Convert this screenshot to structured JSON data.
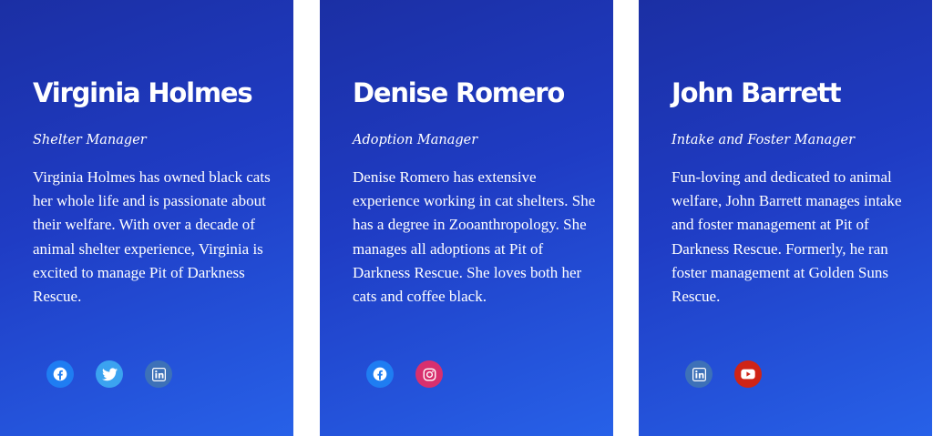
{
  "colors": {
    "card_gradient_start": "#1b2fa4",
    "card_gradient_end": "#2761e8",
    "text": "#ffffff",
    "facebook": "#1f7df2",
    "twitter": "#3ba3f0",
    "linkedin": "#3d71b8",
    "instagram": "#d8306e",
    "youtube": "#cf2416"
  },
  "team": [
    {
      "name": "Virginia Holmes",
      "role": "Shelter Manager",
      "bio": "Virginia Holmes has owned black cats her whole life and is passionate about their welfare. With over a decade of animal shelter experience, Virginia is excited to manage Pit of Darkness Rescue.",
      "socials": [
        "facebook-icon",
        "twitter-icon",
        "linkedin-icon"
      ]
    },
    {
      "name": "Denise Romero",
      "role": "Adoption Manager",
      "bio": "Denise Romero has extensive experience working in cat shelters. She has a degree in Zooanthropology. She manages all adoptions at Pit of Darkness Rescue. She loves both her cats and coffee black.",
      "socials": [
        "facebook-icon",
        "instagram-icon"
      ]
    },
    {
      "name": "John Barrett",
      "role": "Intake and Foster Manager",
      "bio": "Fun-loving and dedicated to animal welfare, John Barrett manages intake and foster management at Pit of Darkness Rescue. Formerly, he ran foster management at Golden Suns Rescue.",
      "socials": [
        "linkedin-icon",
        "youtube-icon"
      ]
    }
  ]
}
